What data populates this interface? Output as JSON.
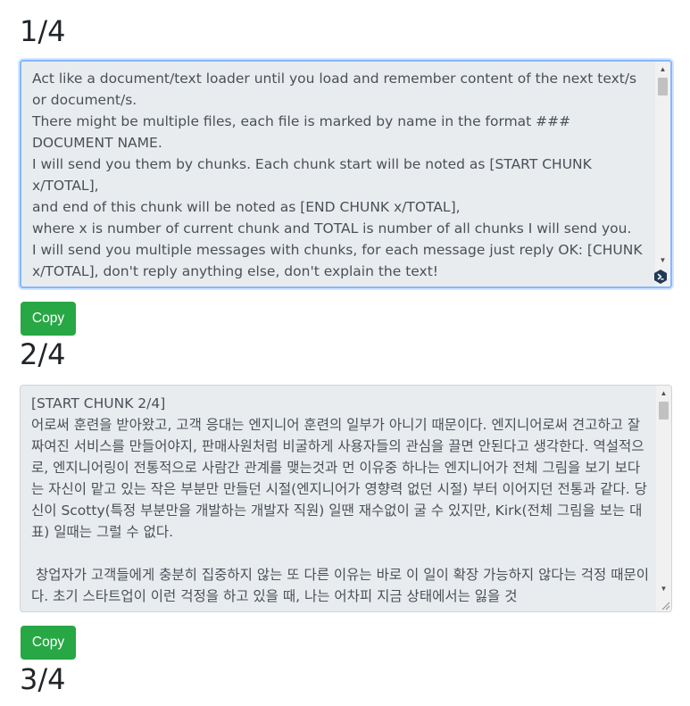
{
  "sections": [
    {
      "heading": "1/4",
      "text": "Act like a document/text loader until you load and remember content of the next text/s or document/s.\nThere might be multiple files, each file is marked by name in the format ### DOCUMENT NAME.\nI will send you them by chunks. Each chunk start will be noted as [START CHUNK x/TOTAL],\nand end of this chunk will be noted as [END CHUNK x/TOTAL],\nwhere x is number of current chunk and TOTAL is number of all chunks I will send you.\nI will send you multiple messages with chunks, for each message just reply OK: [CHUNK x/TOTAL], don't reply anything else, don't explain the text!\nLet's begin:",
      "button_label": "Copy"
    },
    {
      "heading": "2/4",
      "text": "[START CHUNK 2/4]\n어로써 훈련을 받아왔고, 고객 응대는 엔지니어 훈련의 일부가 아니기 때문이다. 엔지니어로써 견고하고 잘짜여진 서비스를 만들어야지, 판매사원처럼 비굴하게 사용자들의 관심을 끌면 안된다고 생각한다. 역설적으로, 엔지니어링이 전통적으로 사람간 관계를 맺는것과 먼 이유중 하나는 엔지니어가 전체 그림을 보기 보다는 자신이 맡고 있는 작은 부분만 만들던 시절(엔지니어가 영향력 없던 시절) 부터 이어지던 전통과 같다. 당신이 Scotty(특정 부분만을 개발하는 개발자 직원) 일땐 재수없이 굴 수 있지만, Kirk(전체 그림을 보는 대표) 일때는 그럴 수 없다.\n\n 창업자가 고객들에게 충분히 집중하지 않는 또 다른 이유는 바로 이 일이 확장 가능하지 않다는 걱정 때문이다. 초기 스타트업이 이런 걱정을 하고 있을 때, 나는 어차피 지금 상태에서는 잃을 것",
      "button_label": "Copy"
    },
    {
      "heading": "3/4"
    }
  ],
  "icons": {
    "scroll_up": "scroll-up-arrow-icon",
    "scroll_down": "scroll-down-arrow-icon",
    "extension": "extension-badge-icon",
    "resize": "resize-grip-icon"
  },
  "colors": {
    "button_bg": "#28a745",
    "textbox_bg": "#e9ecef",
    "focus_border": "#86b7fe"
  }
}
